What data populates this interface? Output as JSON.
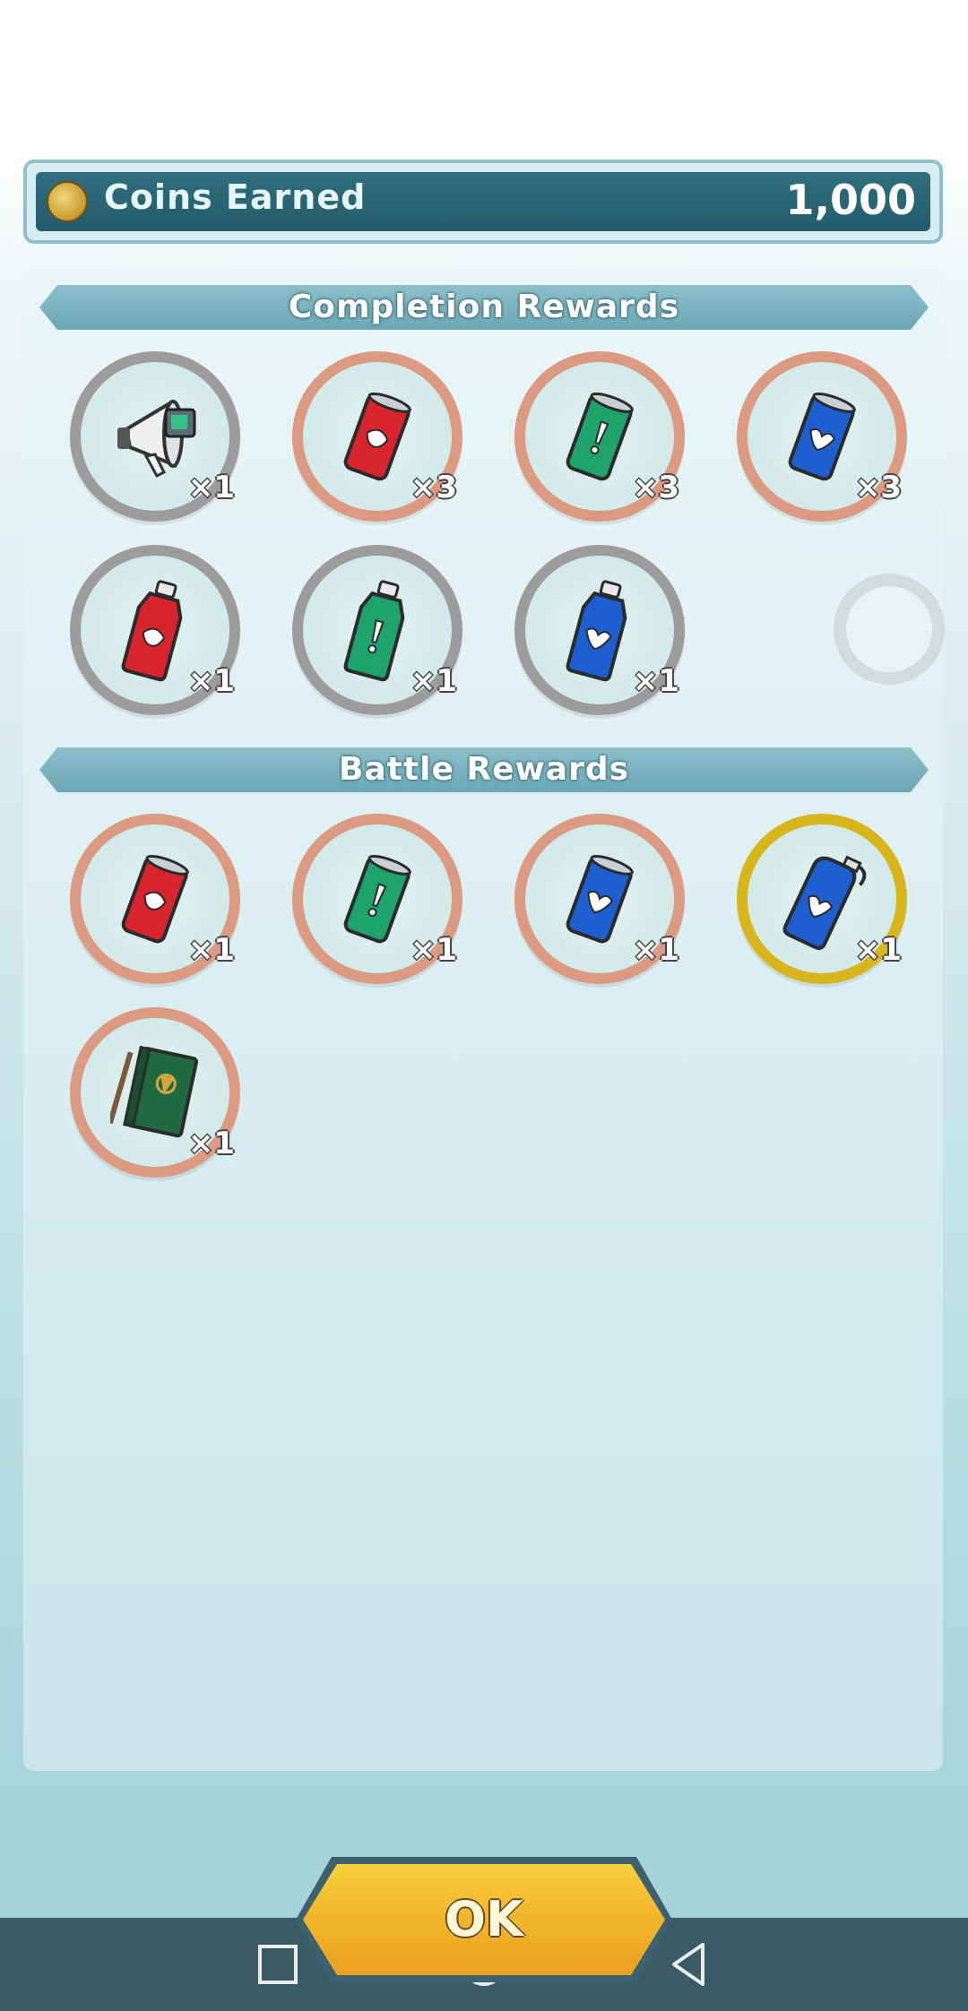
{
  "coins": {
    "label": "Coins Earned",
    "value": "1,000"
  },
  "completion_rewards": {
    "title": "Completion Rewards",
    "items": [
      {
        "icon": "megaphone-icon",
        "quantity": "×1",
        "ring": "silver"
      },
      {
        "icon": "red-can-icon",
        "quantity": "×3",
        "ring": "bronze"
      },
      {
        "icon": "green-can-icon",
        "quantity": "×3",
        "ring": "bronze"
      },
      {
        "icon": "blue-can-icon",
        "quantity": "×3",
        "ring": "bronze"
      },
      {
        "icon": "red-bottle-icon",
        "quantity": "×1",
        "ring": "silver"
      },
      {
        "icon": "green-bottle-icon",
        "quantity": "×1",
        "ring": "silver"
      },
      {
        "icon": "blue-bottle-icon",
        "quantity": "×1",
        "ring": "silver"
      }
    ]
  },
  "battle_rewards": {
    "title": "Battle Rewards",
    "items": [
      {
        "icon": "red-can-icon",
        "quantity": "×1",
        "ring": "bronze"
      },
      {
        "icon": "green-can-icon",
        "quantity": "×1",
        "ring": "bronze"
      },
      {
        "icon": "blue-can-icon",
        "quantity": "×1",
        "ring": "bronze"
      },
      {
        "icon": "blue-flask-icon",
        "quantity": "×1",
        "ring": "gold"
      },
      {
        "icon": "green-notebook-icon",
        "quantity": "×1",
        "ring": "bronze"
      }
    ]
  },
  "ok_button": {
    "label": "OK"
  },
  "colors": {
    "red": "#d8242c",
    "green": "#1ea36d",
    "blue": "#1d5fcf",
    "gold_ring": "#d9b51d",
    "bronze_ring": "#dc9a82",
    "silver_ring": "#9c9c9c"
  }
}
